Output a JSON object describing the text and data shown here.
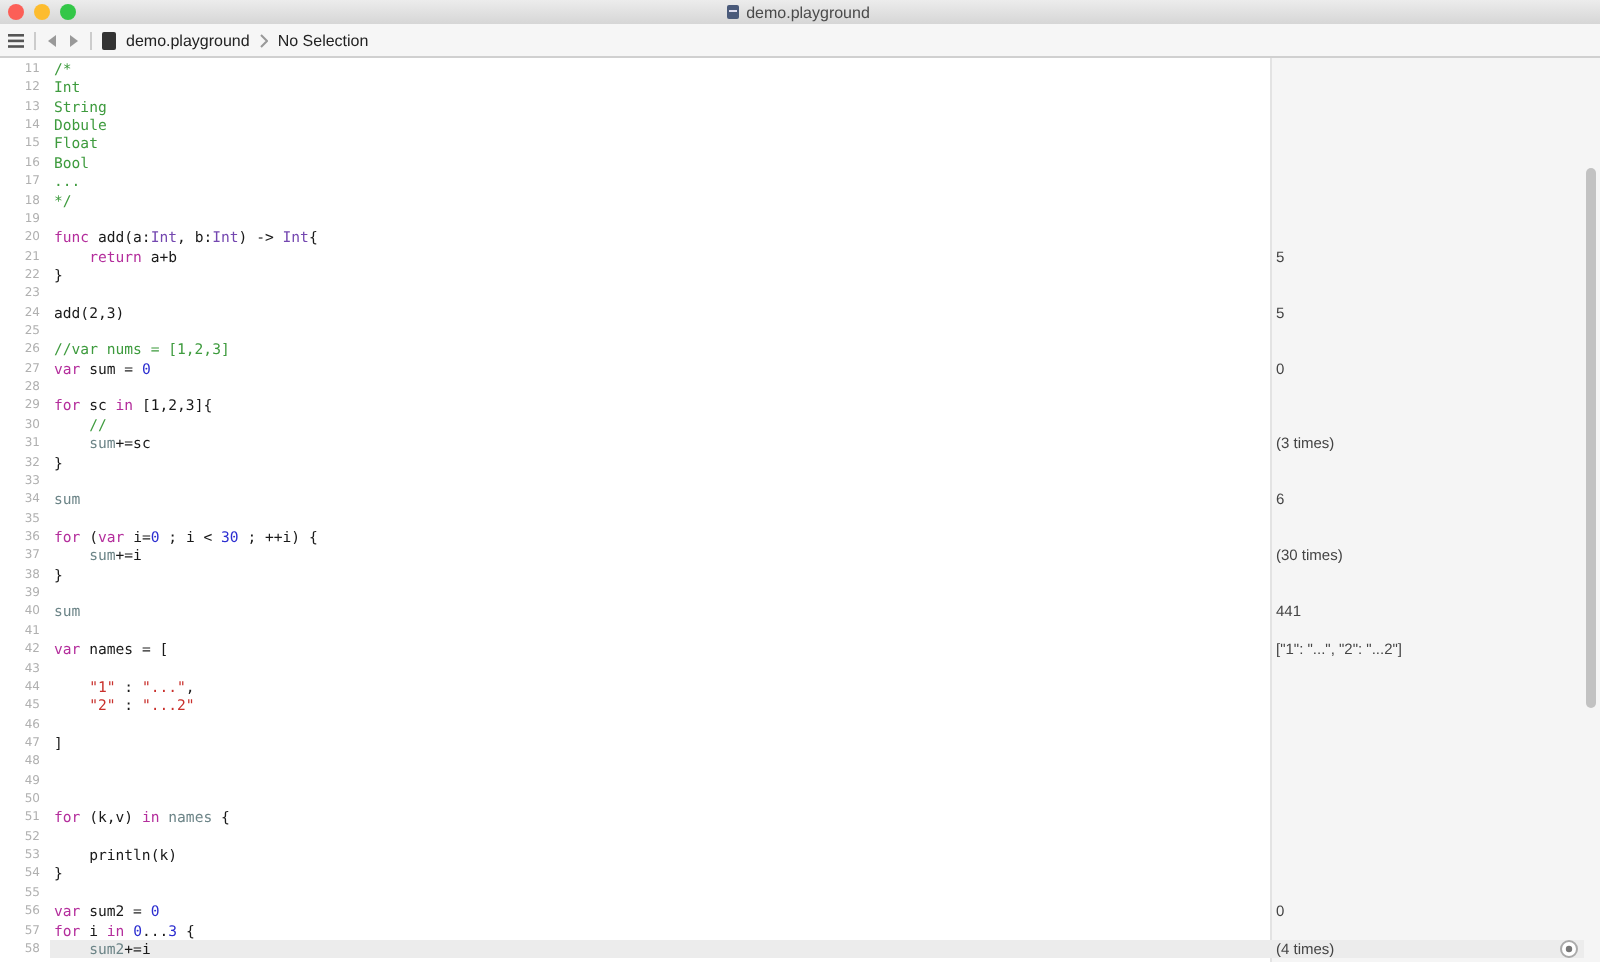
{
  "window": {
    "title": "demo.playground"
  },
  "breadcrumb": {
    "file": "demo.playground",
    "selection": "No Selection"
  },
  "lines": [
    {
      "number": "11",
      "tokens": [
        {
          "kind": "comment",
          "text": "/*"
        }
      ]
    },
    {
      "number": "12",
      "tokens": [
        {
          "kind": "comment",
          "text": "Int"
        }
      ]
    },
    {
      "number": "13",
      "tokens": [
        {
          "kind": "comment",
          "text": "String"
        }
      ]
    },
    {
      "number": "14",
      "tokens": [
        {
          "kind": "comment",
          "text": "Dobule"
        }
      ]
    },
    {
      "number": "15",
      "tokens": [
        {
          "kind": "comment",
          "text": "Float"
        }
      ]
    },
    {
      "number": "16",
      "tokens": [
        {
          "kind": "comment",
          "text": "Bool"
        }
      ]
    },
    {
      "number": "17",
      "tokens": [
        {
          "kind": "comment",
          "text": "..."
        }
      ]
    },
    {
      "number": "18",
      "tokens": [
        {
          "kind": "comment",
          "text": "*/"
        }
      ]
    },
    {
      "number": "19"
    },
    {
      "number": "20",
      "tokens": [
        {
          "kind": "keyword",
          "text": "func"
        },
        {
          "kind": "plain",
          "text": " add(a:"
        },
        {
          "kind": "type",
          "text": "Int"
        },
        {
          "kind": "plain",
          "text": ", b:"
        },
        {
          "kind": "type",
          "text": "Int"
        },
        {
          "kind": "plain",
          "text": ") -> "
        },
        {
          "kind": "type",
          "text": "Int"
        },
        {
          "kind": "plain",
          "text": "{"
        }
      ]
    },
    {
      "number": "21",
      "tokens": [
        {
          "kind": "keyword",
          "text": "    return"
        },
        {
          "kind": "plain",
          "text": " a+b"
        }
      ],
      "result": "5"
    },
    {
      "number": "22",
      "tokens": [
        {
          "kind": "plain",
          "text": "}"
        }
      ]
    },
    {
      "number": "23"
    },
    {
      "number": "24",
      "tokens": [
        {
          "kind": "plain",
          "text": "add(2,3)"
        }
      ],
      "result": "5"
    },
    {
      "number": "25"
    },
    {
      "number": "26",
      "tokens": [
        {
          "kind": "comment",
          "text": "//var nums = [1,2,3]"
        }
      ]
    },
    {
      "number": "27",
      "tokens": [
        {
          "kind": "keyword",
          "text": "var"
        },
        {
          "kind": "plain",
          "text": " sum = "
        },
        {
          "kind": "number",
          "text": "0"
        }
      ],
      "result": "0"
    },
    {
      "number": "28"
    },
    {
      "number": "29",
      "tokens": [
        {
          "kind": "keyword",
          "text": "for"
        },
        {
          "kind": "plain",
          "text": " sc "
        },
        {
          "kind": "keyword",
          "text": "in"
        },
        {
          "kind": "plain",
          "text": " [1,2,3]{"
        }
      ]
    },
    {
      "number": "30",
      "tokens": [
        {
          "kind": "comment",
          "text": "    //"
        }
      ]
    },
    {
      "number": "31",
      "tokens": [
        {
          "kind": "ident",
          "text": "    sum"
        },
        {
          "kind": "plain",
          "text": "+=sc"
        }
      ],
      "result": "(3 times)"
    },
    {
      "number": "32",
      "tokens": [
        {
          "kind": "plain",
          "text": "}"
        }
      ]
    },
    {
      "number": "33"
    },
    {
      "number": "34",
      "tokens": [
        {
          "kind": "ident",
          "text": "sum"
        }
      ],
      "result": "6"
    },
    {
      "number": "35"
    },
    {
      "number": "36",
      "tokens": [
        {
          "kind": "keyword",
          "text": "for"
        },
        {
          "kind": "plain",
          "text": " ("
        },
        {
          "kind": "keyword",
          "text": "var"
        },
        {
          "kind": "plain",
          "text": " i="
        },
        {
          "kind": "number",
          "text": "0"
        },
        {
          "kind": "plain",
          "text": " ; i < "
        },
        {
          "kind": "number",
          "text": "30"
        },
        {
          "kind": "plain",
          "text": " ; ++i) {"
        }
      ]
    },
    {
      "number": "37",
      "tokens": [
        {
          "kind": "ident",
          "text": "    sum"
        },
        {
          "kind": "plain",
          "text": "+=i"
        }
      ],
      "result": "(30 times)"
    },
    {
      "number": "38",
      "tokens": [
        {
          "kind": "plain",
          "text": "}"
        }
      ]
    },
    {
      "number": "39"
    },
    {
      "number": "40",
      "tokens": [
        {
          "kind": "ident",
          "text": "sum"
        }
      ],
      "result": "441"
    },
    {
      "number": "41"
    },
    {
      "number": "42",
      "tokens": [
        {
          "kind": "keyword",
          "text": "var"
        },
        {
          "kind": "plain",
          "text": " names = ["
        }
      ],
      "result": "[\"1\": \"...\", \"2\": \"...2\"]"
    },
    {
      "number": "43"
    },
    {
      "number": "44",
      "tokens": [
        {
          "kind": "string",
          "text": "    \"1\""
        },
        {
          "kind": "plain",
          "text": " : "
        },
        {
          "kind": "string",
          "text": "\"...\""
        },
        {
          "kind": "plain",
          "text": ","
        }
      ]
    },
    {
      "number": "45",
      "tokens": [
        {
          "kind": "string",
          "text": "    \"2\""
        },
        {
          "kind": "plain",
          "text": " : "
        },
        {
          "kind": "string",
          "text": "\"...2\""
        }
      ]
    },
    {
      "number": "46"
    },
    {
      "number": "47",
      "tokens": [
        {
          "kind": "plain",
          "text": "]"
        }
      ]
    },
    {
      "number": "48"
    },
    {
      "number": "49"
    },
    {
      "number": "50"
    },
    {
      "number": "51",
      "tokens": [
        {
          "kind": "keyword",
          "text": "for"
        },
        {
          "kind": "plain",
          "text": " (k,v) "
        },
        {
          "kind": "keyword",
          "text": "in "
        },
        {
          "kind": "ident",
          "text": "names"
        },
        {
          "kind": "plain",
          "text": " {"
        }
      ]
    },
    {
      "number": "52"
    },
    {
      "number": "53",
      "tokens": [
        {
          "kind": "plain",
          "text": "    println(k)"
        }
      ]
    },
    {
      "number": "54",
      "tokens": [
        {
          "kind": "plain",
          "text": "}"
        }
      ]
    },
    {
      "number": "55"
    },
    {
      "number": "56",
      "tokens": [
        {
          "kind": "keyword",
          "text": "var"
        },
        {
          "kind": "plain",
          "text": " sum2 = "
        },
        {
          "kind": "number",
          "text": "0"
        }
      ],
      "result": "0"
    },
    {
      "number": "57",
      "tokens": [
        {
          "kind": "keyword",
          "text": "for"
        },
        {
          "kind": "plain",
          "text": " i "
        },
        {
          "kind": "keyword",
          "text": "in "
        },
        {
          "kind": "number",
          "text": "0"
        },
        {
          "kind": "plain",
          "text": "..."
        },
        {
          "kind": "number",
          "text": "3"
        },
        {
          "kind": "plain",
          "text": " {"
        }
      ]
    },
    {
      "number": "58",
      "current": true,
      "tokens": [
        {
          "kind": "ident",
          "text": "    sum2"
        },
        {
          "kind": "plain",
          "text": "+=i"
        }
      ],
      "result": "(4 times)"
    }
  ]
}
